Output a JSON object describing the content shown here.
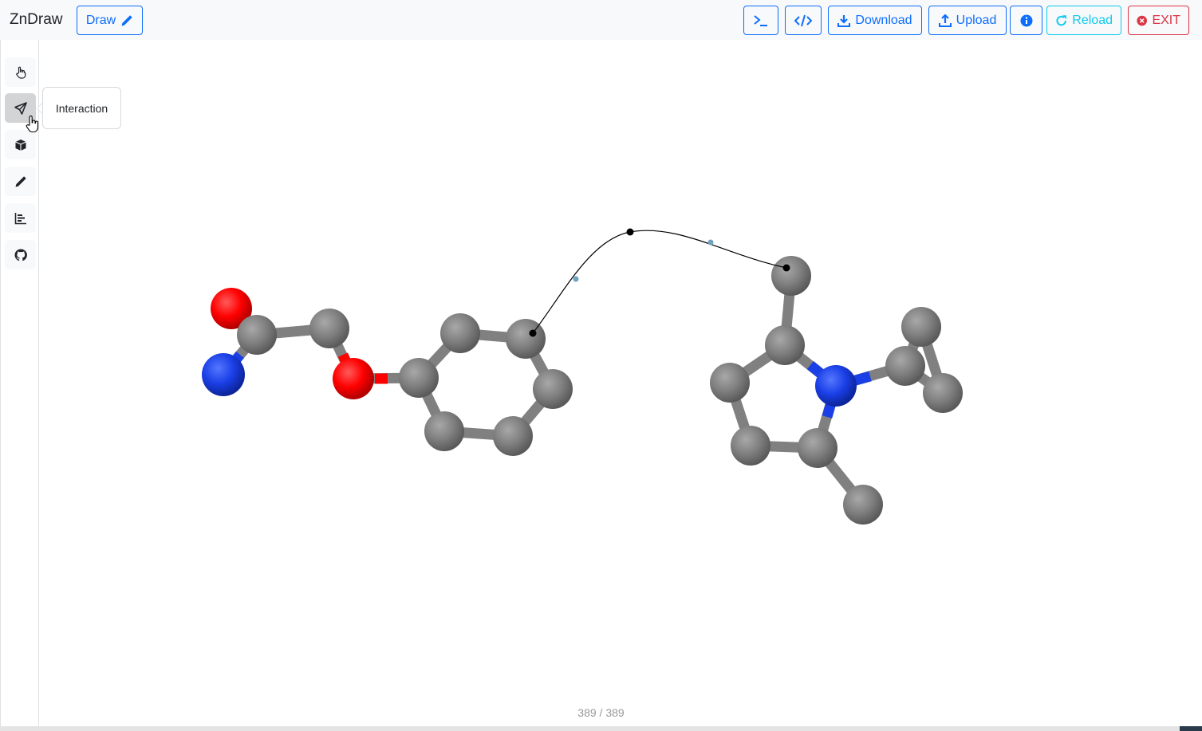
{
  "app": {
    "brand": "ZnDraw"
  },
  "header": {
    "draw_label": "Draw",
    "terminal_icon": "terminal-icon",
    "code_icon": "code-icon",
    "download_label": "Download",
    "upload_label": "Upload",
    "info_icon": "info-circle-icon",
    "reload_label": "Reload",
    "exit_label": "EXIT"
  },
  "sidebar": {
    "items": [
      {
        "name": "selection",
        "icon": "hand-pointer-icon"
      },
      {
        "name": "interaction",
        "icon": "send-icon",
        "active": true
      },
      {
        "name": "geometry",
        "icon": "box-icon"
      },
      {
        "name": "draw",
        "icon": "pencil-icon"
      },
      {
        "name": "analysis",
        "icon": "bar-chart-icon"
      },
      {
        "name": "github",
        "icon": "github-icon"
      }
    ],
    "tooltip": "Interaction"
  },
  "viewer": {
    "frame_counter": "389 / 389",
    "colors": {
      "carbon": "#808080",
      "oxygen": "#ff0000",
      "nitrogen": "#1a3fe6",
      "path": "#000000",
      "path_mid": "#6fa3bf"
    }
  }
}
